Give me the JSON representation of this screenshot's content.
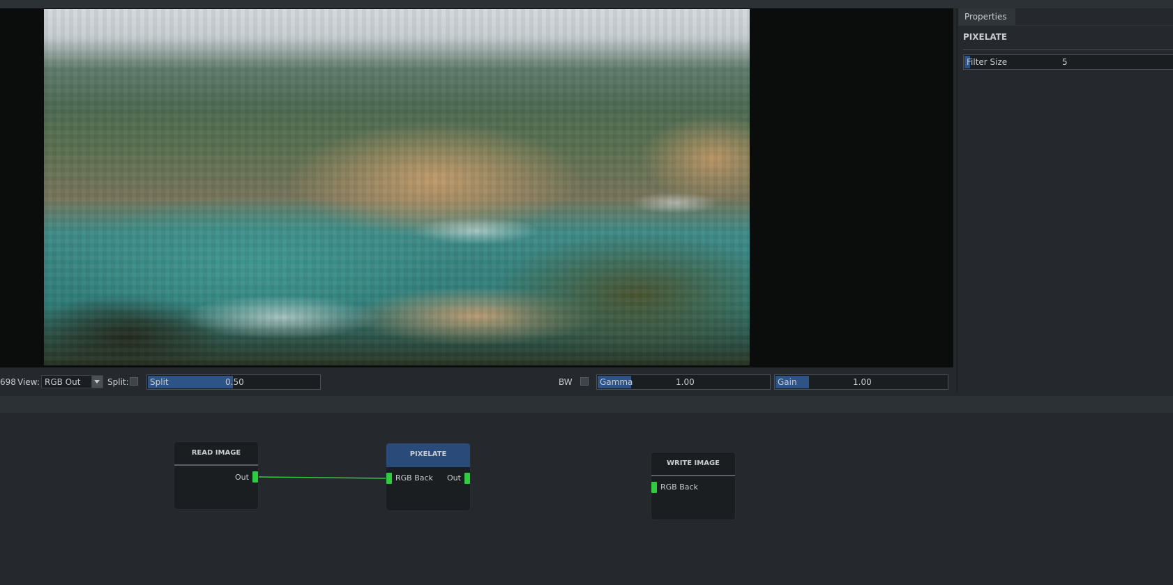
{
  "viewer": {
    "frame_label": "698",
    "view_label": "View:",
    "view_value": "RGB Out",
    "split_label": "Split:",
    "split_slider": {
      "label": "Split",
      "value": "0.50",
      "fraction": 0.5
    },
    "bw_label": "BW",
    "gamma_slider": {
      "label": "Gamma",
      "value": "1.00",
      "fraction": 0.2
    },
    "gain_slider": {
      "label": "Gain",
      "value": "1.00",
      "fraction": 0.2
    }
  },
  "properties": {
    "tab_label": "Properties",
    "node_title": "PIXELATE",
    "fields": [
      {
        "label": "Filter Size",
        "value": "5"
      }
    ]
  },
  "graph": {
    "nodes": [
      {
        "title": "READ IMAGE",
        "outputs": [
          "Out"
        ],
        "inputs": []
      },
      {
        "title": "PIXELATE",
        "inputs": [
          "RGB Back"
        ],
        "outputs": [
          "Out"
        ],
        "selected": true
      },
      {
        "title": "WRITE IMAGE",
        "inputs": [
          "RGB Back"
        ],
        "outputs": []
      }
    ]
  },
  "colors": {
    "accent": "#2e5386",
    "port": "#2ecc40",
    "wire": "#2ecc40",
    "selected_node": "#2a4a7a"
  }
}
